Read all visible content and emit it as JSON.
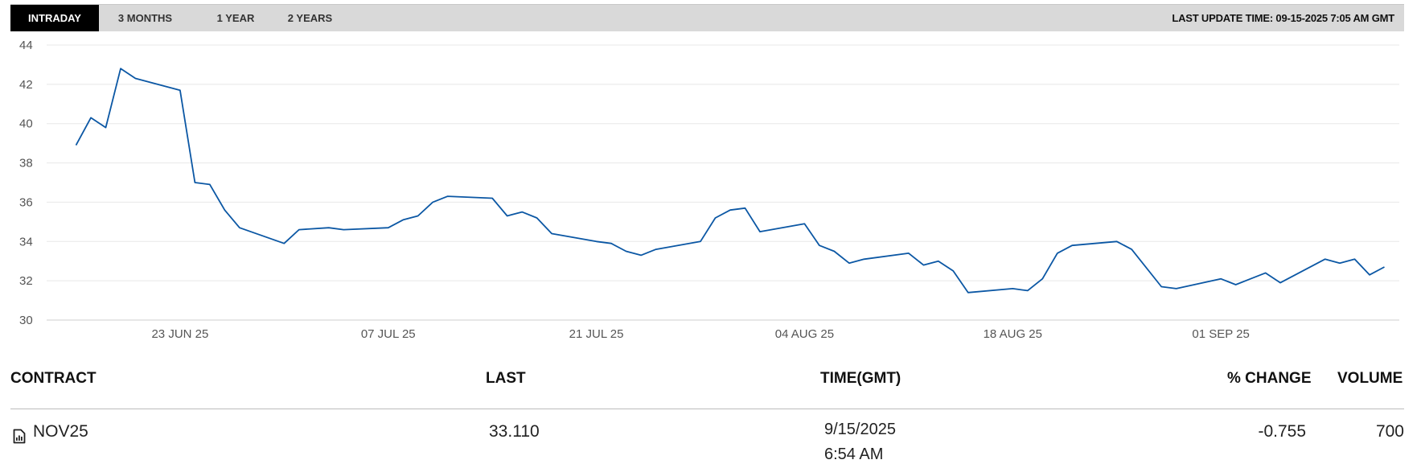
{
  "tabs": [
    {
      "label": "INTRADAY",
      "active": true
    },
    {
      "label": "3 MONTHS",
      "active": false
    },
    {
      "label": "1 YEAR",
      "active": false
    },
    {
      "label": "2 YEARS",
      "active": false
    }
  ],
  "last_update": "LAST UPDATE TIME: 09-15-2025 7:05 AM GMT",
  "chart_data": {
    "type": "line",
    "ylim": [
      30,
      44
    ],
    "y_ticks": [
      "30",
      "32",
      "34",
      "36",
      "38",
      "40",
      "42",
      "44"
    ],
    "x_tick_labels": [
      "23 JUN 25",
      "07 JUL 25",
      "21 JUL 25",
      "04 AUG 25",
      "18 AUG 25",
      "01 SEP 25"
    ],
    "x_tick_dates": [
      "2025-06-23",
      "2025-07-07",
      "2025-07-21",
      "2025-08-04",
      "2025-08-18",
      "2025-09-01"
    ],
    "grid": true,
    "line_color": "#0b57a4",
    "series": [
      {
        "points": [
          [
            "2025-06-16",
            38.9
          ],
          [
            "2025-06-17",
            40.3
          ],
          [
            "2025-06-18",
            39.8
          ],
          [
            "2025-06-19",
            42.8
          ],
          [
            "2025-06-20",
            42.3
          ],
          [
            "2025-06-23",
            41.7
          ],
          [
            "2025-06-24",
            37.0
          ],
          [
            "2025-06-25",
            36.9
          ],
          [
            "2025-06-26",
            35.6
          ],
          [
            "2025-06-27",
            34.7
          ],
          [
            "2025-06-30",
            33.9
          ],
          [
            "2025-07-01",
            34.6
          ],
          [
            "2025-07-03",
            34.7
          ],
          [
            "2025-07-04",
            34.6
          ],
          [
            "2025-07-07",
            34.7
          ],
          [
            "2025-07-08",
            35.1
          ],
          [
            "2025-07-09",
            35.3
          ],
          [
            "2025-07-10",
            36.0
          ],
          [
            "2025-07-11",
            36.3
          ],
          [
            "2025-07-14",
            36.2
          ],
          [
            "2025-07-15",
            35.3
          ],
          [
            "2025-07-16",
            35.5
          ],
          [
            "2025-07-17",
            35.2
          ],
          [
            "2025-07-18",
            34.4
          ],
          [
            "2025-07-21",
            34.0
          ],
          [
            "2025-07-22",
            33.9
          ],
          [
            "2025-07-23",
            33.5
          ],
          [
            "2025-07-24",
            33.3
          ],
          [
            "2025-07-25",
            33.6
          ],
          [
            "2025-07-28",
            34.0
          ],
          [
            "2025-07-29",
            35.2
          ],
          [
            "2025-07-30",
            35.6
          ],
          [
            "2025-07-31",
            35.7
          ],
          [
            "2025-08-01",
            34.5
          ],
          [
            "2025-08-04",
            34.9
          ],
          [
            "2025-08-05",
            33.8
          ],
          [
            "2025-08-06",
            33.5
          ],
          [
            "2025-08-07",
            32.9
          ],
          [
            "2025-08-08",
            33.1
          ],
          [
            "2025-08-11",
            33.4
          ],
          [
            "2025-08-12",
            32.8
          ],
          [
            "2025-08-13",
            33.0
          ],
          [
            "2025-08-14",
            32.5
          ],
          [
            "2025-08-15",
            31.4
          ],
          [
            "2025-08-18",
            31.6
          ],
          [
            "2025-08-19",
            31.5
          ],
          [
            "2025-08-20",
            32.1
          ],
          [
            "2025-08-21",
            33.4
          ],
          [
            "2025-08-22",
            33.8
          ],
          [
            "2025-08-25",
            34.0
          ],
          [
            "2025-08-26",
            33.6
          ],
          [
            "2025-08-28",
            31.7
          ],
          [
            "2025-08-29",
            31.6
          ],
          [
            "2025-09-01",
            32.1
          ],
          [
            "2025-09-02",
            31.8
          ],
          [
            "2025-09-03",
            32.1
          ],
          [
            "2025-09-04",
            32.4
          ],
          [
            "2025-09-05",
            31.9
          ],
          [
            "2025-09-08",
            33.1
          ],
          [
            "2025-09-09",
            32.9
          ],
          [
            "2025-09-10",
            33.1
          ],
          [
            "2025-09-11",
            32.3
          ],
          [
            "2025-09-12",
            32.7
          ]
        ]
      }
    ]
  },
  "table": {
    "headers": {
      "contract": "CONTRACT",
      "last": "LAST",
      "time": "TIME(GMT)",
      "change": "% CHANGE",
      "volume": "VOLUME"
    },
    "rows": [
      {
        "icon": "chart-file-icon",
        "contract": "NOV25",
        "last": "33.110",
        "date": "9/15/2025",
        "time": "6:54 AM",
        "change": "-0.755",
        "volume": "700"
      }
    ]
  }
}
